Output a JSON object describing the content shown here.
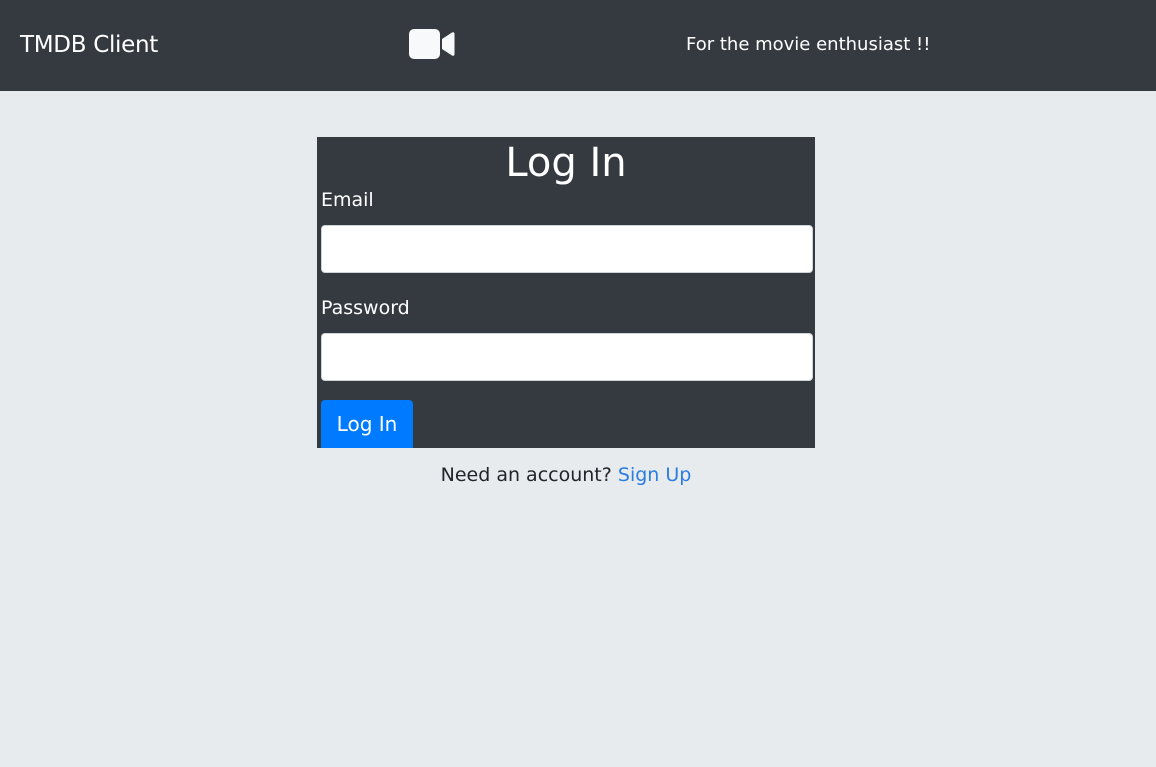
{
  "navbar": {
    "brand": "TMDB Client",
    "logo_icon": "video-camera-icon",
    "tagline": "For the movie enthusiast !!"
  },
  "login_form": {
    "title": "Log In",
    "email_label": "Email",
    "email_value": "",
    "password_label": "Password",
    "password_value": "",
    "submit_label": "Log In"
  },
  "signup_prompt": {
    "text": "Need an account?",
    "link_label": "Sign Up"
  },
  "colors": {
    "navbar_bg": "#343a40",
    "page_bg": "#e7ebee",
    "primary": "#007bff",
    "link": "#2a7de1"
  }
}
